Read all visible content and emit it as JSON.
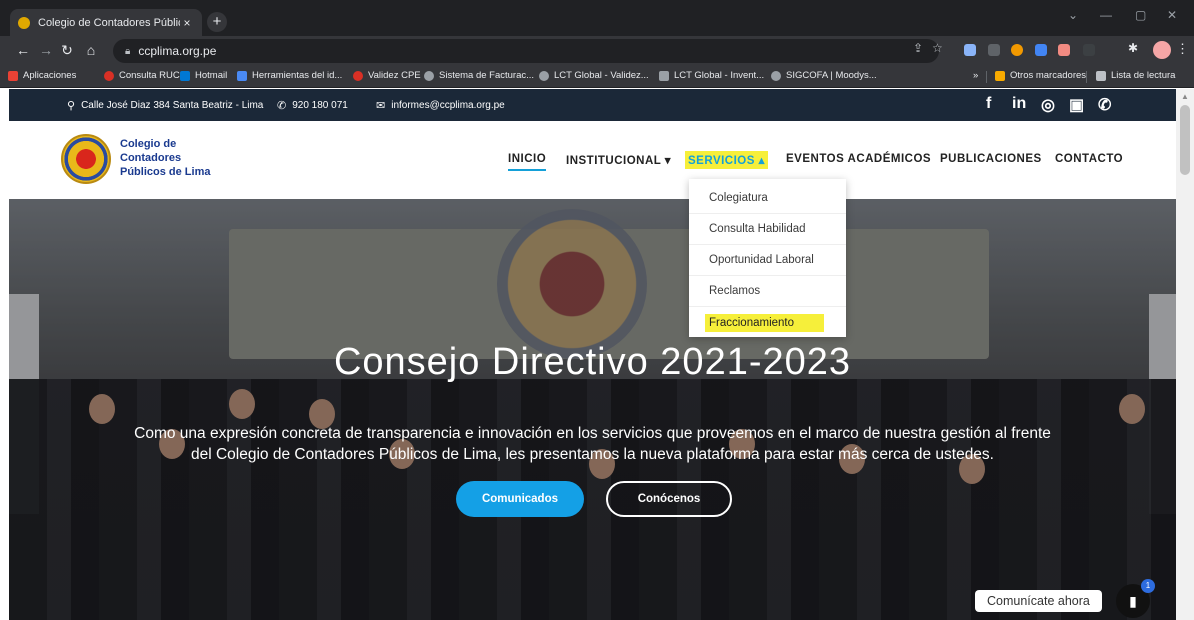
{
  "browser": {
    "tab_title": "Colegio de Contadores Públicos",
    "tab_close": "×",
    "new_tab": "+",
    "url": "ccplima.org.pe",
    "bookmarks": [
      {
        "label": "Aplicaciones",
        "color": "#e94235"
      },
      {
        "label": "Consulta RUC",
        "color": "#d93025"
      },
      {
        "label": "Hotmail",
        "color": "#0078d4"
      },
      {
        "label": "Herramientas del id...",
        "color": "#4a8af4"
      },
      {
        "label": "Validez CPE",
        "color": "#d93025"
      },
      {
        "label": "Sistema de Facturac...",
        "color": "#9aa0a6"
      },
      {
        "label": "LCT Global - Validez...",
        "color": "#9aa0a6"
      },
      {
        "label": "LCT Global - Invent...",
        "color": "#9aa0a6"
      },
      {
        "label": "SIGCOFA | Moodys...",
        "color": "#9aa0a6"
      }
    ],
    "bookmarks_overflow": "»",
    "other_bookmarks": "Otros marcadores",
    "reading_list": "Lista de lectura"
  },
  "topbar": {
    "address": "Calle José Diaz 384 Santa Beatriz - Lima",
    "phone": "920 180 071",
    "email": "informes@ccplima.org.pe",
    "social": [
      "f",
      "in",
      "◎",
      "▣",
      "✆"
    ]
  },
  "header": {
    "logo_line1": "Colegio de",
    "logo_line2": "Contadores",
    "logo_line3": "Públicos de Lima",
    "nav": [
      "INICIO",
      "INSTITUCIONAL ▾",
      "SERVICIOS ▴",
      "EVENTOS ACADÉMICOS",
      "PUBLICACIONES",
      "CONTACTO"
    ]
  },
  "dropdown": {
    "items": [
      "Colegiatura",
      "Consulta Habilidad",
      "Oportunidad Laboral",
      "Reclamos",
      "Fraccionamiento"
    ]
  },
  "hero": {
    "title": "Consejo Directivo 2021-2023",
    "text": "Como una expresión concreta de transparencia e innovación en los servicios que proveemos en el marco de nuestra gestión al frente del Colegio de Contadores Públicos de Lima, les presentamos la nueva plataforma para estar más cerca de ustedes.",
    "btn_primary": "Comunicados",
    "btn_secondary": "Conócenos"
  },
  "chat": {
    "label": "Comunícate ahora",
    "badge": "1"
  },
  "colors": {
    "accent": "#14a0d8",
    "highlight": "#f6ef3a",
    "topbar": "#1b2838"
  }
}
